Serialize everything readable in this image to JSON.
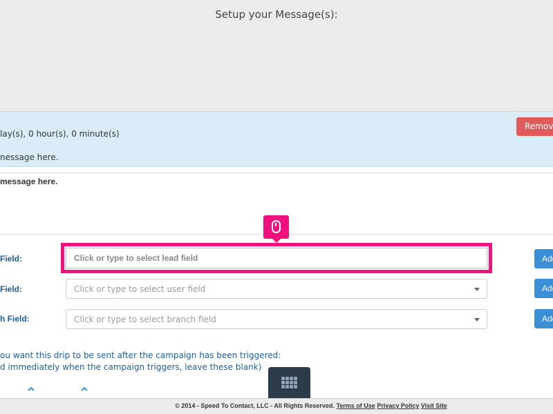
{
  "header": {
    "title": "Setup your Message(s):"
  },
  "drip": {
    "delay_text": "lay(s), 0 hour(s), 0 minute(s)",
    "message_preview": "nessage here.",
    "remove_label": "Remove"
  },
  "editor": {
    "text": "message here."
  },
  "fields": [
    {
      "label": "Field:",
      "placeholder": "Click or type to select lead field",
      "add_label": "Add"
    },
    {
      "label": "Field:",
      "placeholder": "Click or type to select user field",
      "add_label": "Add"
    },
    {
      "label": "h Field:",
      "placeholder": "Click or type to select branch field",
      "add_label": "Add"
    }
  ],
  "trigger": {
    "line1": "ou want this drip to be sent after the campaign has been triggered:",
    "line2": "d immediately when the campaign triggers, leave these blank)"
  },
  "footer": {
    "copyright": "© 2014 - Speed To Contact, LLC - All Rights Reserved.",
    "terms": "Terms of Use",
    "privacy": "Privacy Policy",
    "visit": "Visit Site"
  },
  "icons": {
    "cursor": "mouse-icon",
    "grid": "grid-icon",
    "chevron": "chevron-up-icon",
    "caret": "caret-down-icon"
  },
  "colors": {
    "highlight": "#f0117e",
    "remove": "#e05b5b",
    "add": "#3a8fd6",
    "info_bg": "#d9ecf8",
    "label": "#1a5e9c"
  }
}
